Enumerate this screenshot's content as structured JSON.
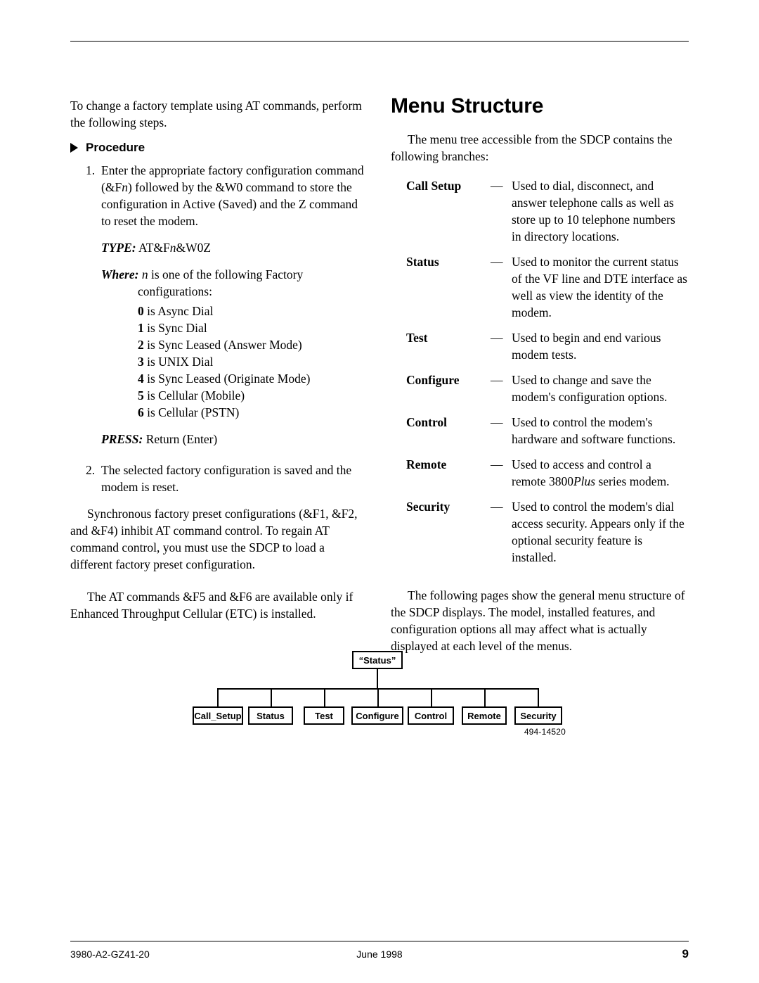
{
  "left_column": {
    "intro": "To change a factory template using AT commands, perform the following steps.",
    "procedure_heading": "Procedure",
    "steps": [
      {
        "num": "1.",
        "text_1": "Enter the appropriate factory configuration command (&F",
        "italic_n": "n",
        "text_2": ") followed by the &W0 command to store the configuration in Active (Saved) and the Z command to reset the modem."
      },
      {
        "num": "2.",
        "text_1": "The selected factory configuration is saved and the modem is reset.",
        "italic_n": "",
        "text_2": ""
      }
    ],
    "type_label": "TYPE:",
    "type_value_pre": "AT&F",
    "type_value_italic": "n",
    "type_value_post": "&W0Z",
    "where_label": "Where:",
    "where_italic": "n",
    "where_text": "is one of the following Factory configurations:",
    "config_list": [
      {
        "value": "0",
        "text": "is Async Dial"
      },
      {
        "value": "1",
        "text": "is Sync Dial"
      },
      {
        "value": "2",
        "text": "is Sync Leased (Answer Mode)"
      },
      {
        "value": "3",
        "text": "is UNIX Dial"
      },
      {
        "value": "4",
        "text": "is Sync Leased (Originate Mode)"
      },
      {
        "value": "5",
        "text": "is Cellular (Mobile)"
      },
      {
        "value": "6",
        "text": "is Cellular (PSTN)"
      }
    ],
    "press_label": "PRESS:",
    "press_value": "Return (Enter)",
    "para_sync": "Synchronous factory preset configurations (&F1, &F2, and &F4) inhibit AT command control. To regain AT command control, you must use the SDCP to load a different factory preset configuration.",
    "para_etc": "The AT commands &F5 and &F6 are available only if Enhanced Throughput Cellular (ETC) is installed."
  },
  "right_column": {
    "heading": "Menu Structure",
    "intro": "The menu tree accessible from the SDCP contains the following branches:",
    "dash": "—",
    "branches": [
      {
        "term": "Call Setup",
        "desc": "Used to dial, disconnect, and answer telephone calls as well as store up to 10 telephone numbers in directory locations."
      },
      {
        "term": "Status",
        "desc": "Used to monitor the current status of the VF line and DTE interface as well as view the identity of the modem."
      },
      {
        "term": "Test",
        "desc": "Used to begin and end various modem tests."
      },
      {
        "term": "Configure",
        "desc": "Used to change and save the modem's configuration options."
      },
      {
        "term": "Control",
        "desc": "Used to control the modem's hardware and software functions."
      },
      {
        "term": "Remote",
        "desc_pre": "Used to access and control a remote 3800",
        "desc_italic": "Plus",
        "desc_post": " series modem."
      },
      {
        "term": "Security",
        "desc": "Used to control the modem's dial access security. Appears only if the optional security feature is installed."
      }
    ],
    "closing": "The following pages show the general menu structure of the SDCP displays. The model, installed features, and configuration options all may affect what is actually displayed at each level of the menus."
  },
  "diagram": {
    "root": "“Status”",
    "children": [
      "Call_Setup",
      "Status",
      "Test",
      "Configure",
      "Control",
      "Remote",
      "Security"
    ],
    "part_number": "494-14520"
  },
  "footer": {
    "left": "3980-A2-GZ41-20",
    "center": "June 1998",
    "right": "9"
  }
}
